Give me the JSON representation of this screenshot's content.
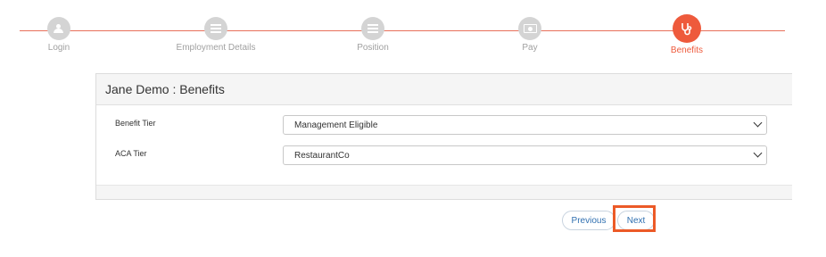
{
  "stepper": {
    "steps": [
      {
        "label": "Login",
        "icon": "user-plus-icon"
      },
      {
        "label": "Employment Details",
        "icon": "list-icon"
      },
      {
        "label": "Position",
        "icon": "list-icon"
      },
      {
        "label": "Pay",
        "icon": "money-icon"
      },
      {
        "label": "Benefits",
        "icon": "stethoscope-icon"
      }
    ],
    "active_step": "Benefits",
    "accent_color": "#ee5a3c",
    "inactive_color": "#d4d4d4"
  },
  "panel": {
    "title": "Jane Demo : Benefits",
    "fields": [
      {
        "label": "Benefit Tier",
        "value": "Management Eligible"
      },
      {
        "label": "ACA Tier",
        "value": "RestaurantCo"
      }
    ]
  },
  "actions": {
    "previous_label": "Previous",
    "next_label": "Next",
    "highlight_color": "#ec5a27"
  }
}
